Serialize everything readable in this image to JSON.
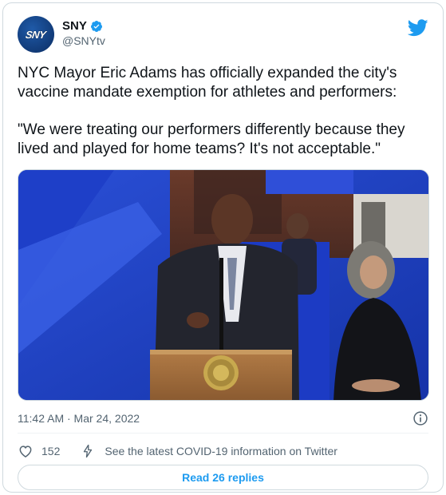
{
  "author": {
    "display_name": "SNY",
    "handle": "@SNYtv",
    "avatar_text": "SNY",
    "verified": true
  },
  "tweet": {
    "paragraphs": [
      "NYC Mayor Eric Adams has officially expanded the city's vaccine mandate exemption for athletes and performers:",
      "\"We were treating our performers differently because they lived and played for home teams? It's not acceptable.\""
    ],
    "timestamp": "11:42 AM · Mar 24, 2022"
  },
  "actions": {
    "like_count": "152",
    "covid_link": "See the latest COVID-19 information on Twitter",
    "replies_button": "Read 26 replies"
  },
  "icons": {
    "verified": "verified-badge-icon",
    "brand": "twitter-bird-icon",
    "info": "info-icon",
    "like": "heart-icon",
    "covid": "lightning-icon"
  },
  "colors": {
    "accent": "#1d9bf0",
    "text": "#0f1419",
    "muted": "#536471",
    "border": "#cfd9de",
    "avatar": "#1f5aa8"
  }
}
